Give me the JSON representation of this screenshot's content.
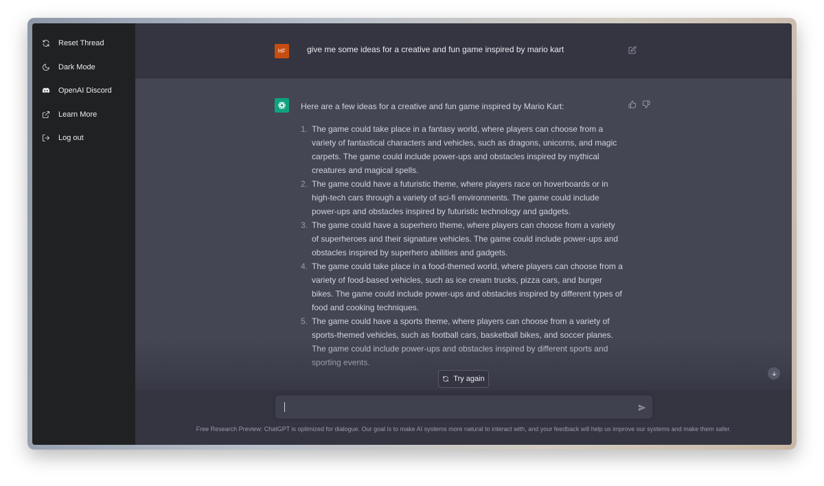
{
  "sidebar": {
    "items": [
      {
        "label": "Reset Thread",
        "icon": "refresh-icon"
      },
      {
        "label": "Dark Mode",
        "icon": "moon-icon"
      },
      {
        "label": "OpenAI Discord",
        "icon": "discord-icon"
      },
      {
        "label": "Learn More",
        "icon": "external-link-icon"
      },
      {
        "label": "Log out",
        "icon": "logout-icon"
      }
    ]
  },
  "conversation": {
    "user": {
      "avatar_initials": "HF",
      "avatar_color": "#c64d0f",
      "message": "give me some ideas for a creative and fun game inspired by mario kart"
    },
    "assistant": {
      "avatar_color": "#10a37f",
      "intro": "Here are a few ideas for a creative and fun game inspired by Mario Kart:",
      "items": [
        {
          "num": "1.",
          "text": "The game could take place in a fantasy world, where players can choose from a variety of fantastical characters and vehicles, such as dragons, unicorns, and magic carpets. The game could include power-ups and obstacles inspired by mythical creatures and magical spells."
        },
        {
          "num": "2.",
          "text": "The game could have a futuristic theme, where players race on hoverboards or in high-tech cars through a variety of sci-fi environments. The game could include power-ups and obstacles inspired by futuristic technology and gadgets."
        },
        {
          "num": "3.",
          "text": "The game could have a superhero theme, where players can choose from a variety of superheroes and their signature vehicles. The game could include power-ups and obstacles inspired by superhero abilities and gadgets."
        },
        {
          "num": "4.",
          "text": "The game could take place in a food-themed world, where players can choose from a variety of food-based vehicles, such as ice cream trucks, pizza cars, and burger bikes. The game could include power-ups and obstacles inspired by different types of food and cooking techniques."
        },
        {
          "num": "5.",
          "text": "The game could have a sports theme, where players can choose from a variety of sports-themed vehicles, such as football cars, basketball bikes, and soccer planes. The game could include power-ups and obstacles inspired by different sports and sporting events."
        }
      ]
    }
  },
  "actions": {
    "try_again_label": "Try again"
  },
  "composer": {
    "value": "",
    "placeholder": ""
  },
  "footer": {
    "text": "Free Research Preview: ChatGPT is optimized for dialogue. Our goal is to make AI systems more natural to interact with, and your feedback will help us improve our systems and make them safer."
  },
  "colors": {
    "sidebar_bg": "#202123",
    "main_bg": "#343541",
    "assistant_bg": "#444654",
    "accent": "#10a37f"
  }
}
